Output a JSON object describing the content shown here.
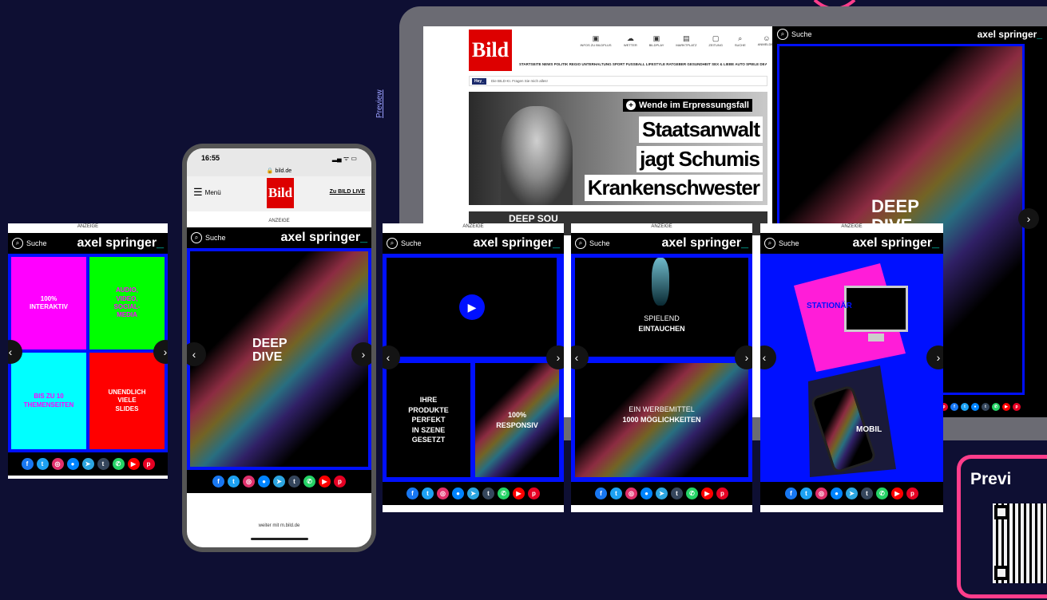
{
  "common": {
    "anzeige": "ANZEIGE",
    "suche": "Suche",
    "logo_text": "axel springer",
    "logo_underscore": "_",
    "prev_arrow": "‹",
    "next_arrow": "›",
    "social_icons": [
      {
        "icon": "facebook-icon",
        "glyph": "f",
        "color": "#1877f2"
      },
      {
        "icon": "twitter-icon",
        "glyph": "t",
        "color": "#1da1f2"
      },
      {
        "icon": "instagram-icon",
        "glyph": "◎",
        "color": "#e1306c"
      },
      {
        "icon": "messenger-icon",
        "glyph": "●",
        "color": "#0084ff"
      },
      {
        "icon": "telegram-icon",
        "glyph": "➤",
        "color": "#2ca5e0"
      },
      {
        "icon": "tumblr-icon",
        "glyph": "t",
        "color": "#35465c"
      },
      {
        "icon": "whatsapp-icon",
        "glyph": "✆",
        "color": "#25d366"
      },
      {
        "icon": "youtube-icon",
        "glyph": "▶",
        "color": "#ff0000"
      },
      {
        "icon": "pinterest-icon",
        "glyph": "p",
        "color": "#e60023"
      }
    ]
  },
  "card1": {
    "tiles": [
      {
        "text": "100%\nINTERAKTIV",
        "bg": "#ff00ff",
        "fg": "#ffffff"
      },
      {
        "text": "AUDIO,\nVIDEO,\nSOCIAL-\nMEDIA",
        "bg": "#00ff00",
        "fg": "#ff00ff"
      },
      {
        "text": "BIS ZU 10\nTHEMENSEITEN",
        "bg": "#00ffff",
        "fg": "#ff00ff"
      },
      {
        "text": "UNENDLICH\nVIELE\nSLIDES",
        "bg": "#ff0000",
        "fg": "#ffffff"
      }
    ]
  },
  "phone": {
    "time": "16:55",
    "url": "bild.de",
    "menu": "Menü",
    "bild_logo": "Bild",
    "live_link": "Zu BILD LIVE",
    "deep_dive": "DEEP\nDIVE",
    "footer": "weiter mit m.bild.de"
  },
  "card3": {
    "tile1": "IHRE\nPRODUKTE\nPERFEKT\nIN SZENE\nGESETZT",
    "tile2": "100%\nRESPONSIV"
  },
  "card4": {
    "top_line1": "SPIELEND",
    "top_line2": "EINTAUCHEN",
    "bottom_line1": "EIN WERBEMITTEL",
    "bottom_line2": "1000 MÖGLICHKEITEN"
  },
  "card5": {
    "stationaer": "STATIONÄR",
    "mobil": "MOBIL"
  },
  "tablet": {
    "preview_label": "Preview",
    "bild_logo": "Bild",
    "nav_icons": [
      "INFOS ZU BILDPLUS",
      "WETTER",
      "BILDPLAY",
      "MARKTPLATZ",
      "ZEITUNG",
      "SUCHE",
      "ANMELDEN"
    ],
    "nav_menu": "STARTSEITE NEWS POLITIK REGIO UNTERHALTUNG SPORT FUSSBALL LIFESTYLE RATGEBER GESUNDHEIT SEX & LIEBE AUTO SPIELE DEALS",
    "hey_badge": "Hey_",
    "hey_text": "Die BILD-KI. Fragen Sie mich alles!",
    "kicker": "Wende im Erpressungsfall",
    "headline1": "Staatsanwalt",
    "headline2": "jagt Schumis",
    "headline3": "Krankenschwester",
    "sub_headline": "DEEP SOU",
    "ad_deep": "DEEP",
    "ad_dive": "DIVE"
  },
  "qr": {
    "label": "Previ"
  },
  "colors": {
    "background": "#0e0f33",
    "accent_pink": "#ff3d8b",
    "stage_blue": "#0010ff",
    "tablet_frame": "#6b6b73"
  }
}
